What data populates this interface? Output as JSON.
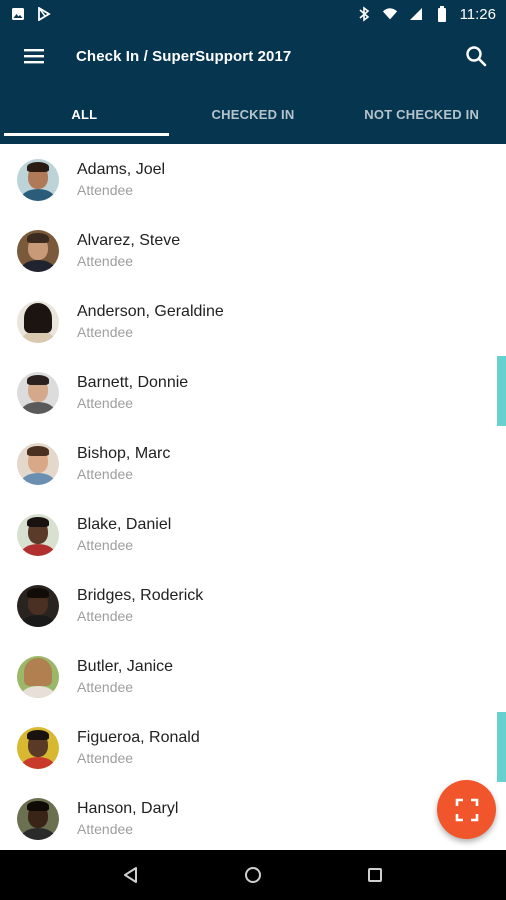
{
  "status_bar": {
    "time": "11:26",
    "icons": [
      "image-icon",
      "play-store-icon",
      "bluetooth-icon",
      "wifi-icon",
      "cell-signal-icon",
      "battery-icon"
    ]
  },
  "app_bar": {
    "title": "Check In / SuperSupport 2017",
    "menu_icon": "hamburger-menu-icon",
    "search_icon": "search-icon",
    "background": "#06364f"
  },
  "tabs": [
    {
      "label": "ALL",
      "active": true
    },
    {
      "label": "CHECKED IN",
      "active": false
    },
    {
      "label": "NOT CHECKED IN",
      "active": false
    }
  ],
  "attendees": [
    {
      "name": "Adams, Joel",
      "role": "Attendee"
    },
    {
      "name": "Alvarez, Steve",
      "role": "Attendee"
    },
    {
      "name": "Anderson, Geraldine",
      "role": "Attendee"
    },
    {
      "name": "Barnett, Donnie",
      "role": "Attendee"
    },
    {
      "name": "Bishop, Marc",
      "role": "Attendee"
    },
    {
      "name": "Blake, Daniel",
      "role": "Attendee"
    },
    {
      "name": "Bridges, Roderick",
      "role": "Attendee"
    },
    {
      "name": "Butler, Janice",
      "role": "Attendee"
    },
    {
      "name": "Figueroa, Ronald",
      "role": "Attendee"
    },
    {
      "name": "Hanson, Daryl",
      "role": "Attendee"
    }
  ],
  "fab": {
    "icon": "scan-icon",
    "color": "#f0552c"
  },
  "nav_bar": {
    "icons": [
      "back-icon",
      "home-icon",
      "recents-icon"
    ]
  },
  "accent": "#66d1cf"
}
